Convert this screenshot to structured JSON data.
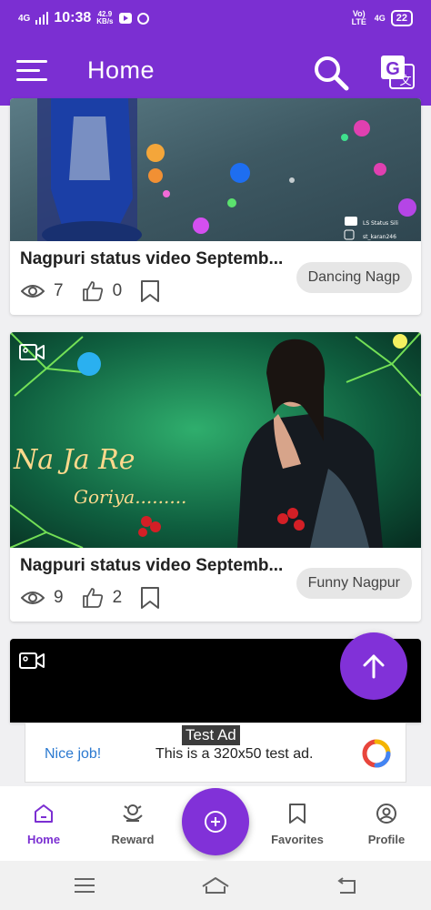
{
  "status_bar": {
    "network": "4G",
    "time": "10:38",
    "speed_value": "42.9",
    "speed_unit": "KB/s",
    "carrier": "Vo) LTE",
    "network_right": "4G",
    "battery": "22"
  },
  "appbar": {
    "title": "Home",
    "menu_icon": "hamburger-icon",
    "search_icon": "search-icon",
    "translate_icon": "translate-icon",
    "color": "#7b2fd2"
  },
  "feed": [
    {
      "title": "Nagpuri status video Septemb...",
      "views": "7",
      "likes": "0",
      "tag": "Dancing Nagp",
      "watermark_1": "LS Status Sili",
      "watermark_2": "st_karan246"
    },
    {
      "title": "Nagpuri status video Septemb...",
      "views": "9",
      "likes": "2",
      "tag": "Funny Nagpur",
      "overlay_1": "Na Ja Re",
      "overlay_2": "Goriya........."
    }
  ],
  "ad": {
    "badge": "Test Ad",
    "action": "Nice job!",
    "text": "This is a 320x50 test ad."
  },
  "bottom_nav": {
    "items": [
      {
        "label": "Home",
        "icon": "home-icon"
      },
      {
        "label": "Reward",
        "icon": "reward-icon"
      },
      {
        "label": "Favorites",
        "icon": "bookmark-icon"
      },
      {
        "label": "Profile",
        "icon": "profile-icon"
      }
    ],
    "active": "Home",
    "accent": "#7b2fd2"
  }
}
